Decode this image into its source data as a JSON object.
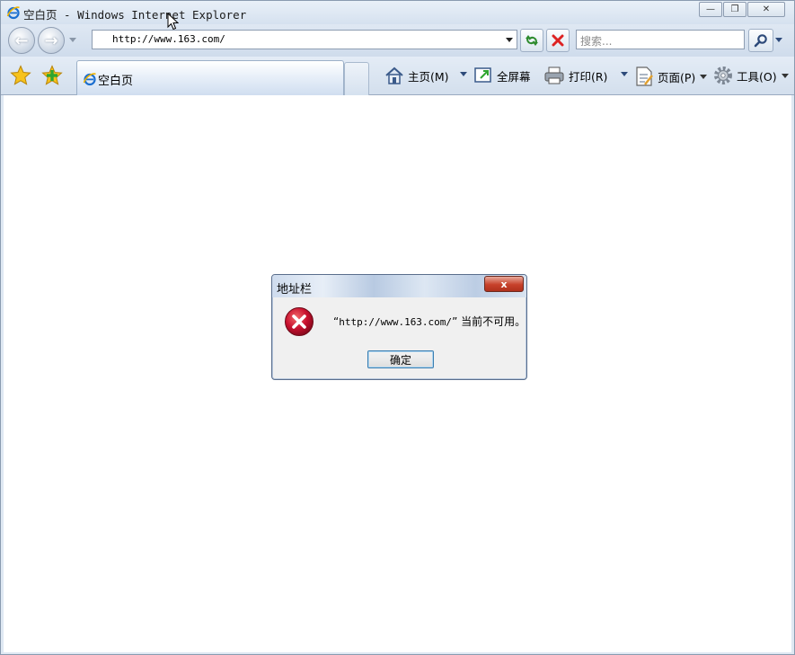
{
  "window": {
    "title": "空白页 - Windows Internet Explorer",
    "minimize": "—",
    "restore": "❐",
    "close": "✕"
  },
  "navbar": {
    "back_glyph": "←",
    "forward_glyph": "→",
    "address": "http://www.163.com/",
    "search_placeholder": "搜索..."
  },
  "tabs": [
    {
      "label": "空白页",
      "active": true
    }
  ],
  "commandbar": {
    "home": "主页(M)",
    "fullscreen": "全屏幕",
    "print": "打印(R)",
    "page": "页面(P)",
    "tools": "工具(O)"
  },
  "dialog": {
    "title": "地址栏",
    "close": "x",
    "message_prefix": "“",
    "message_url": "http://www.163.com/",
    "message_suffix": "” 当前不可用。",
    "ok": "确定"
  },
  "colors": {
    "frame": "#dfe8f3",
    "accent": "#2d4a7a",
    "error": "#c8102e",
    "close_button": "#c7412b"
  }
}
